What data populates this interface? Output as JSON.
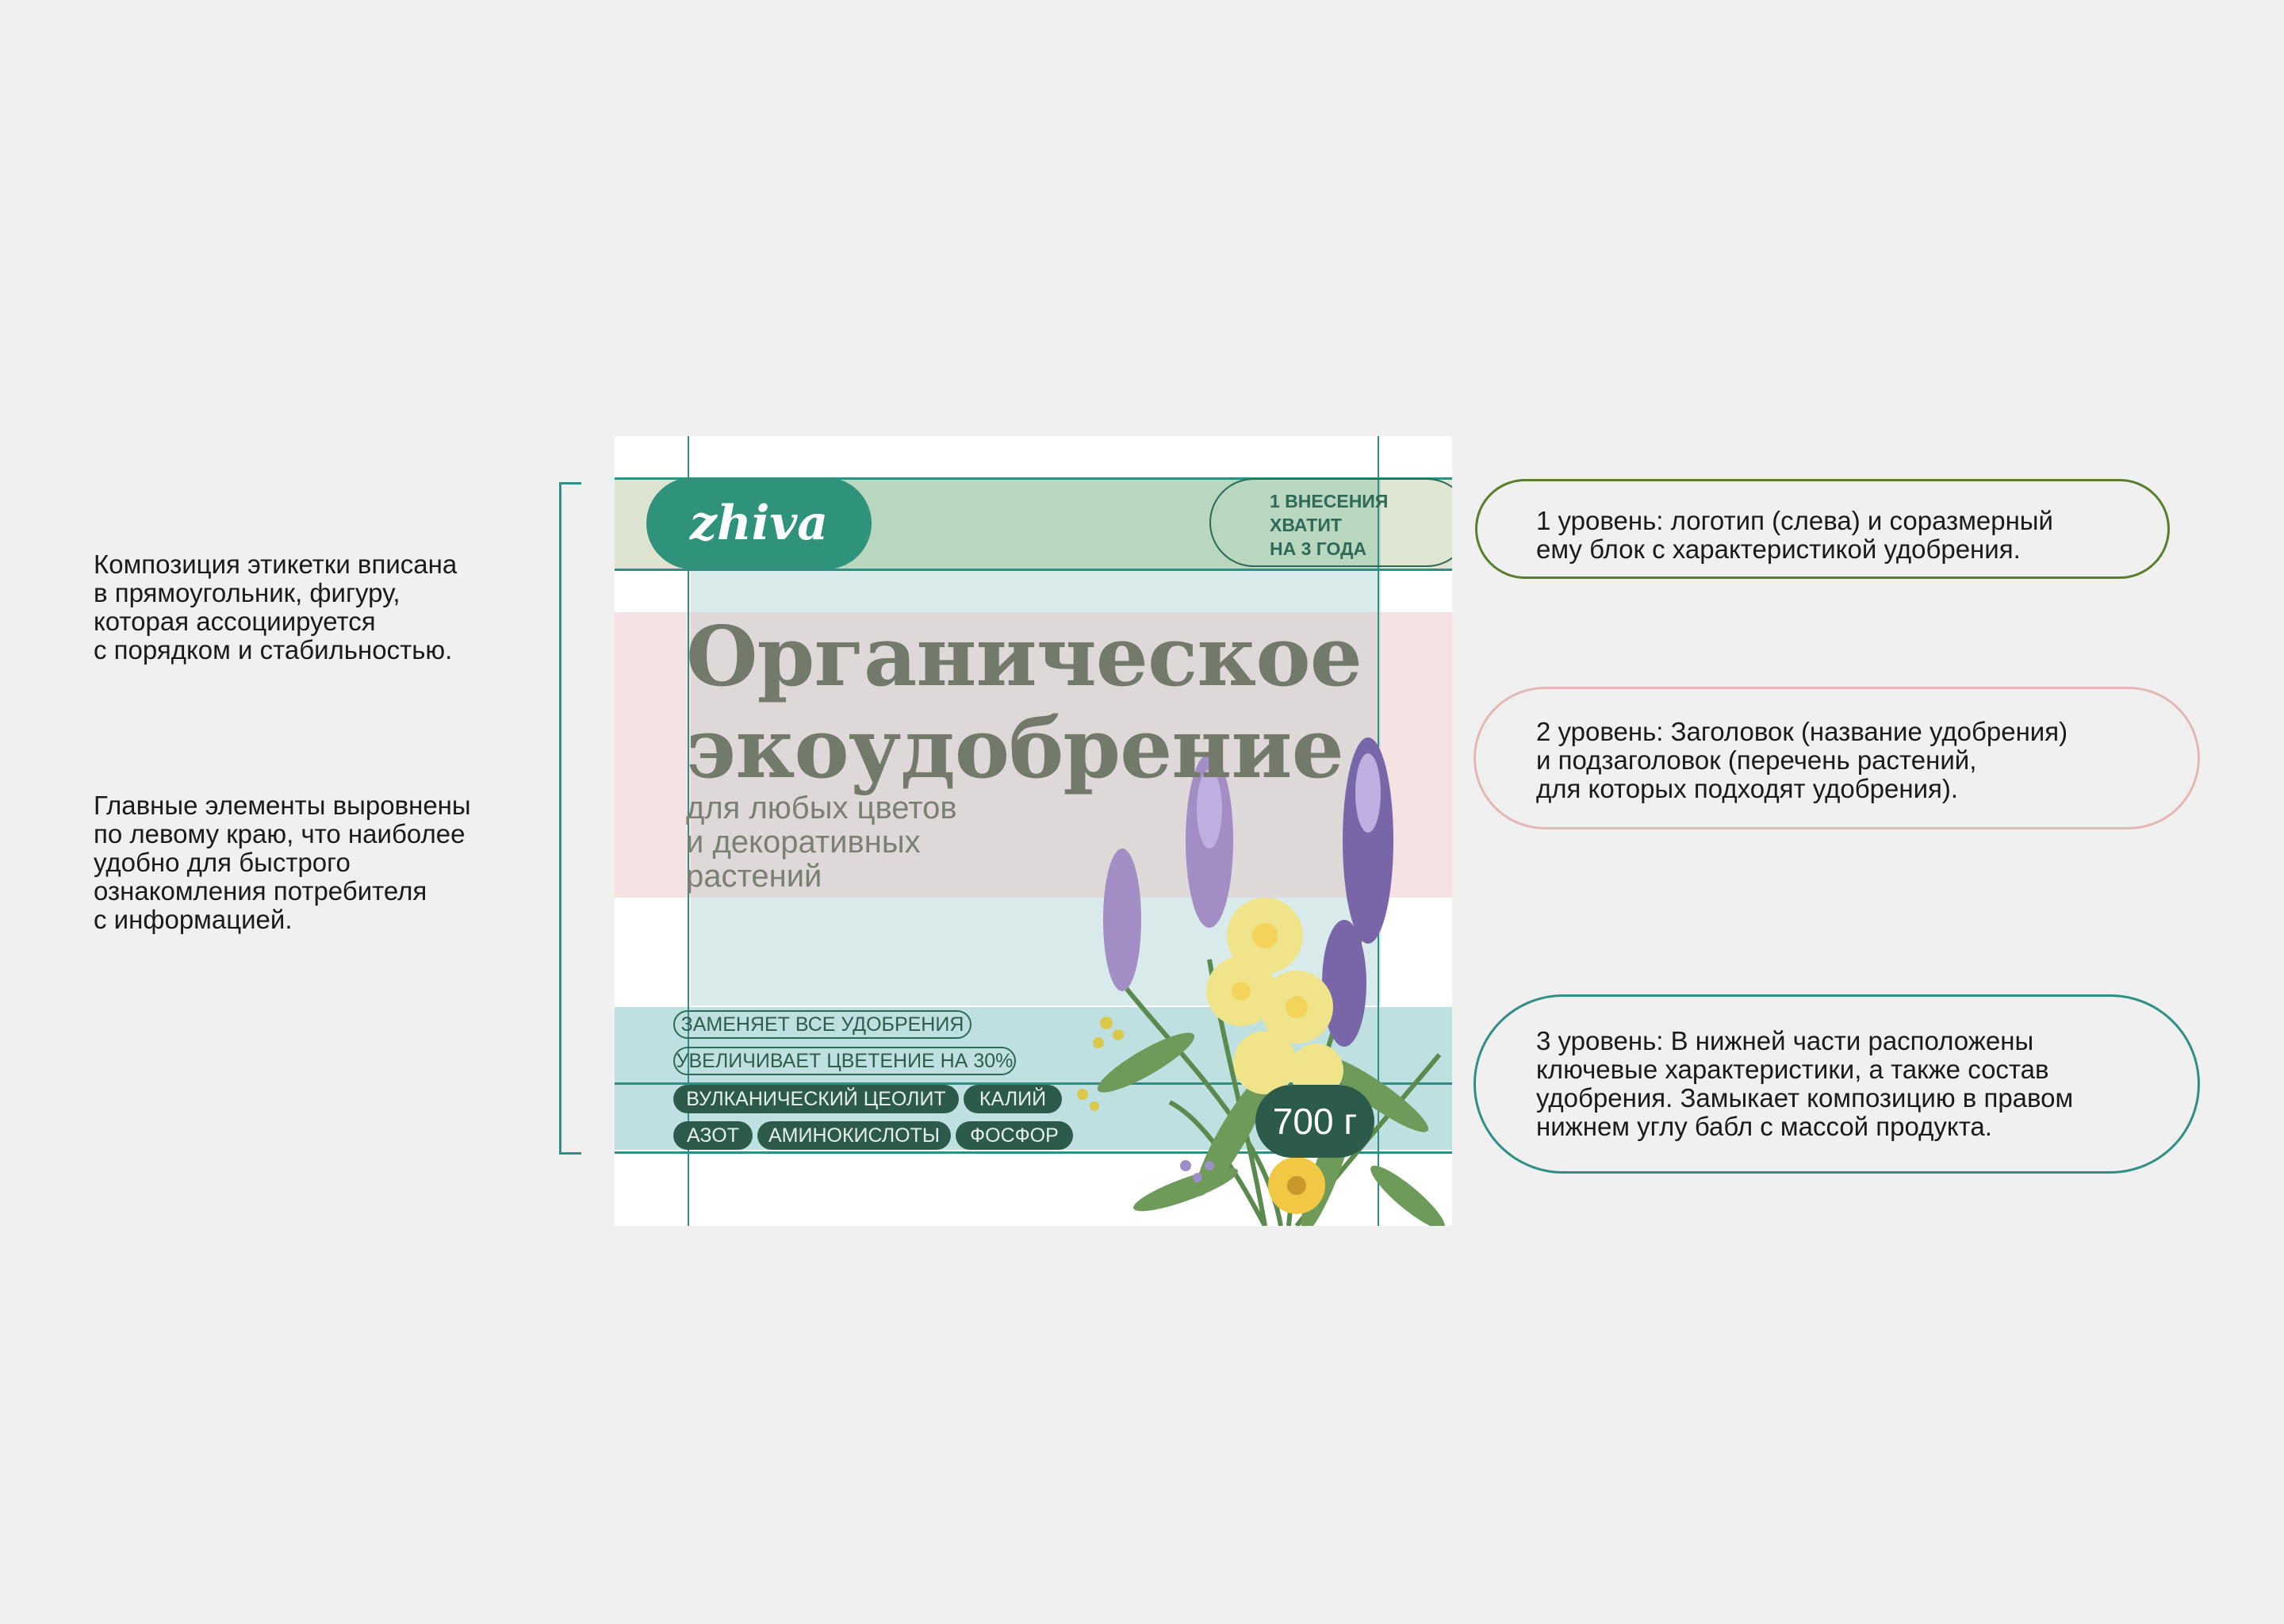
{
  "left_notes": {
    "note_1": "Композиция этикетки вписана\nв прямоугольник, фигуру,\nкоторая ассоциируется\nс порядком и стабильностью.",
    "note_2": "Главные элементы выровнены\nпо левому краю, что наиболее\nудобно для быстрого\nознакомления потребителя\nс информацией."
  },
  "label": {
    "logo_text": "zhiva",
    "info_lines": [
      "1 ВНЕСЕНИЯ",
      "ХВАТИТ",
      "НА 3 ГОДА"
    ],
    "title_lines": [
      "Органическое",
      "экоудобрение"
    ],
    "subtitle_lines": [
      "для любых цветов",
      "и декоративных",
      "растений"
    ],
    "benefits": [
      "ЗАМЕНЯЕТ ВСЕ УДОБРЕНИЯ",
      "УВЕЛИЧИВАЕТ ЦВЕТЕНИЕ НА 30%"
    ],
    "ingredients": [
      "ВУЛКАНИЧЕСКИЙ ЦЕОЛИТ",
      "КАЛИЙ",
      "АЗОТ",
      "АМИНОКИСЛОТЫ",
      "ФОСФОР"
    ],
    "weight": "700 г"
  },
  "callouts": {
    "level_1": "1 уровень:  логотип (слева) и соразмерный\nему блок  с характеристикой удобрения.",
    "level_2": "2 уровень:  Заголовок (название удобрения)\nи подзаголовок (перечень растений,\nдля которых подходят удобрения).",
    "level_3": "3 уровень:  В нижней части расположены\nключевые характеристики, а также состав\nудобрения. Замыкает композицию в правом\nнижнем углу бабл с массой продукта."
  },
  "colors": {
    "accent_teal": "#2f8f86",
    "logo_green": "#2f927a",
    "dark_green": "#2c5b4b",
    "title_gray": "#737a6c",
    "callout_1_border": "#5a7d2e",
    "callout_2_border": "#e4b7b4",
    "callout_3_border": "#2f8f86"
  }
}
